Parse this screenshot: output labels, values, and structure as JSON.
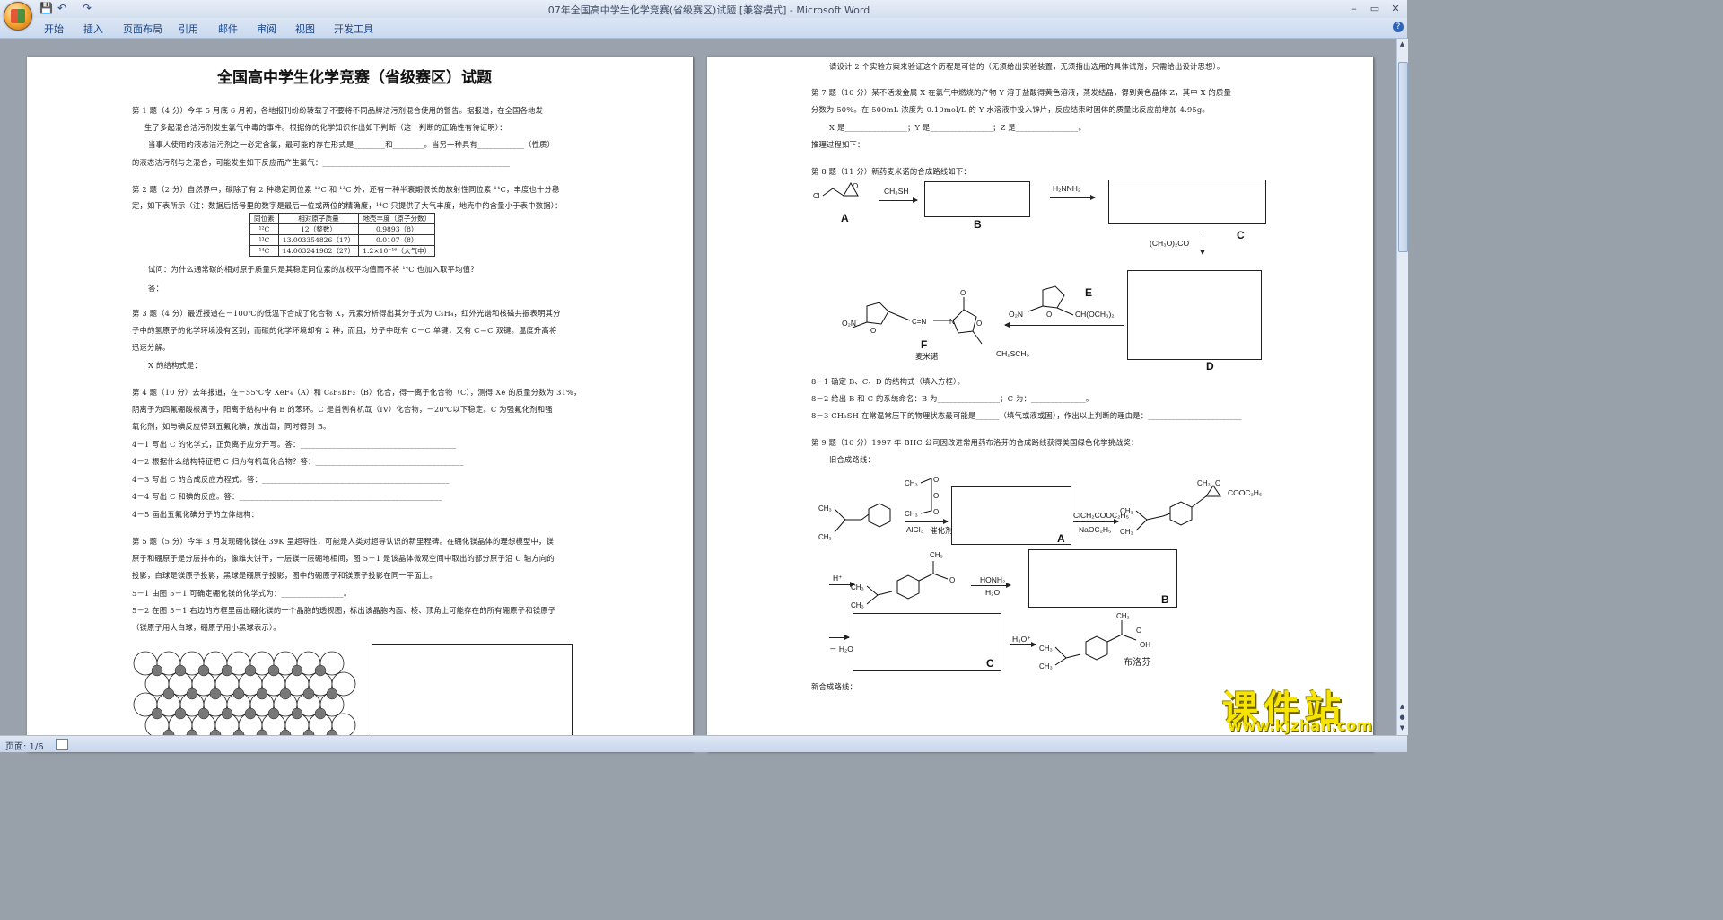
{
  "window": {
    "title": "07年全国高中学生化学竞赛(省级赛区)试题 [兼容模式] - Microsoft Word",
    "min": "–",
    "max": "▭",
    "close": "✕"
  },
  "quick_access": [
    "💾",
    "↶",
    "↷"
  ],
  "ribbon_tabs": [
    "开始",
    "插入",
    "页面布局",
    "引用",
    "邮件",
    "审阅",
    "视图",
    "开发工具"
  ],
  "status": {
    "page": "页面: 1/6"
  },
  "page1": {
    "title": "全国高中学生化学竞赛（省级赛区）试题",
    "lines": [
      "第 1 题（4 分）今年 5 月底 6 月初，各地报刊纷纷转载了不要将不同品牌洁污剂混合使用的警告。据报道，在全国各地发",
      "生了多起混合洁污剂发生氯气中毒的事件。根据你的化学知识作出如下判断（这一判断的正确性有待证明）：",
      "当事人使用的液态洁污剂之一必定含氯，最可能的存在形式是________和________。当另一种具有____________（性质）",
      "的液态洁污剂与之混合，可能发生如下反应而产生氯气：________________________________________________",
      "第 2 题（2 分）自然界中，碳除了有 2 种稳定同位素 ¹²C 和 ¹³C 外，还有一种半衰期很长的放射性同位素 ¹⁴C，丰度也十分稳",
      "定，如下表所示（注：数据后括号里的数字是最后一位或两位的精确度，¹⁴C 只提供了大气丰度，地壳中的含量小于表中数据）：",
      "试问：为什么通常碳的相对原子质量只是其稳定同位素的加权平均值而不将 ¹⁴C 也加入取平均值？",
      "答：",
      "第 3 题（4 分）最近报道在－100℃的低温下合成了化合物 X，元素分析得出其分子式为 C₅H₄，红外光谱和核磁共振表明其分",
      "子中的氢原子的化学环境没有区别，而碳的化学环境却有 2 种，而且，分子中既有 C－C 单键，又有 C＝C 双键。温度升高将",
      "迅速分解。",
      "X 的结构式是：",
      "第 4 题（10 分）去年报道，在－55℃令 XeF₄（A）和 C₆F₅BF₂（B）化合，得一离子化合物（C），测得 Xe 的质量分数为 31%，",
      "阴离子为四氟硼酸根离子，阳离子结构中有 B 的苯环。C 是首例有机氙（IV）化合物，－20℃以下稳定。C 为强氟化剂和强",
      "氧化剂，如与碘反应得到五氟化碘，放出氙，同时得到 B。",
      "4－1  写出 C 的化学式，正负离子应分开写。答：________________________________________",
      "4－2  根据什么结构特征把  C 归为有机氙化合物？答：______________________________________",
      "4－3  写出 C 的合成反应方程式。答：________________________________________________",
      "4－4  写出 C 和碘的反应。答：____________________________________________________",
      "4－5  画出五氟化碘分子的立体结构：",
      "第 5 题（5 分）今年 3 月发现硼化镁在 39K 呈超导性，可能是人类对超导认识的新里程碑。在硼化镁晶体的理想模型中，镁",
      "原子和硼原子是分层排布的，像维夫饼干，一层镁一层硼地相间，图 5－1 是该晶体微观空间中取出的部分原子沿 C 轴方向的",
      "投影，白球是镁原子投影，黑球是硼原子投影，图中的硼原子和镁原子投影在同一平面上。",
      "5－1  由图 5－1 可确定硼化镁的化学式为：________________。",
      "5－2  在图 5－1 右边的方框里画出硼化镁的一个晶胞的透视图，标出该晶胞内面、棱、顶角上可能存在的所有硼原子和镁原子",
      "（镁原子用大白球，硼原子用小黑球表示）。"
    ],
    "isotope_table": [
      [
        "同位素",
        "相对原子质量",
        "地壳丰度（原子分数）"
      ],
      [
        "¹²C",
        "12（整数）",
        "0.9893（8）"
      ],
      [
        "¹³C",
        "13.003354826（17）",
        "0.0107（8）"
      ],
      [
        "¹⁴C",
        "14.003241982（27）",
        "1.2×10⁻¹⁶（大气中）"
      ]
    ]
  },
  "page2": {
    "lines": [
      "请设计 2 个实验方案来验证这个历程是可信的（无须给出实验装置，无须指出选用的具体试剂，只需给出设计思想）。",
      "第 7 题（10 分）某不活泼金属 X 在氯气中燃烧的产物 Y 溶于盐酸得黄色溶液，蒸发结晶，得到黄色晶体 Z，其中 X 的质量",
      "分数为 50%。在 500mL 浓度为 0.10mol/L 的 Y 水溶液中投入锌片，反应结束时固体的质量比反应前增加 4.95g。",
      "X 是________________；Y 是________________；Z 是________________。",
      "推理过程如下：",
      "第 8 题（11 分）新药麦米诺的合成路线如下：",
      "8－1  确定 B、C、D 的结构式（填入方框）。",
      "8－2  给出 B 和 C 的系统命名：B 为________________；C 为：______________。",
      "8－3 CH₃SH 在常温常压下的物理状态最可能是______（填气或液或固），作出以上判断的理由是：________________________",
      "第 9 题（10 分）1997 年 BHC 公司因改进常用药布洛芬的合成路线获得美国绿色化学挑战奖：",
      "旧合成路线：",
      "新合成路线："
    ],
    "scheme8": {
      "labels": [
        "A",
        "B",
        "C",
        "D",
        "E",
        "F"
      ],
      "reagents": [
        "CH₃SH",
        "H₂NNH₂",
        "(CH₃O)₂CO"
      ],
      "name_F": "麦米诺",
      "e_group": "CH(OCH₃)₂",
      "f_group": "CH₂SCH₃",
      "nitro": "O₂N"
    },
    "scheme9": {
      "labels": [
        "A",
        "B",
        "C"
      ],
      "reagents": [
        "AlCl₃",
        "催化剂",
        "ClCH₂COOC₂H₅",
        "NaOC₂H₅",
        "H⁺",
        "HONH₂",
        "H₂O",
        "－ H₂O",
        "H₃O⁺"
      ],
      "product_name": "布洛芬",
      "ester": "COOC₂H₅"
    }
  },
  "watermark": {
    "cn": "课件站",
    "url": "www.kjzhan.com"
  }
}
